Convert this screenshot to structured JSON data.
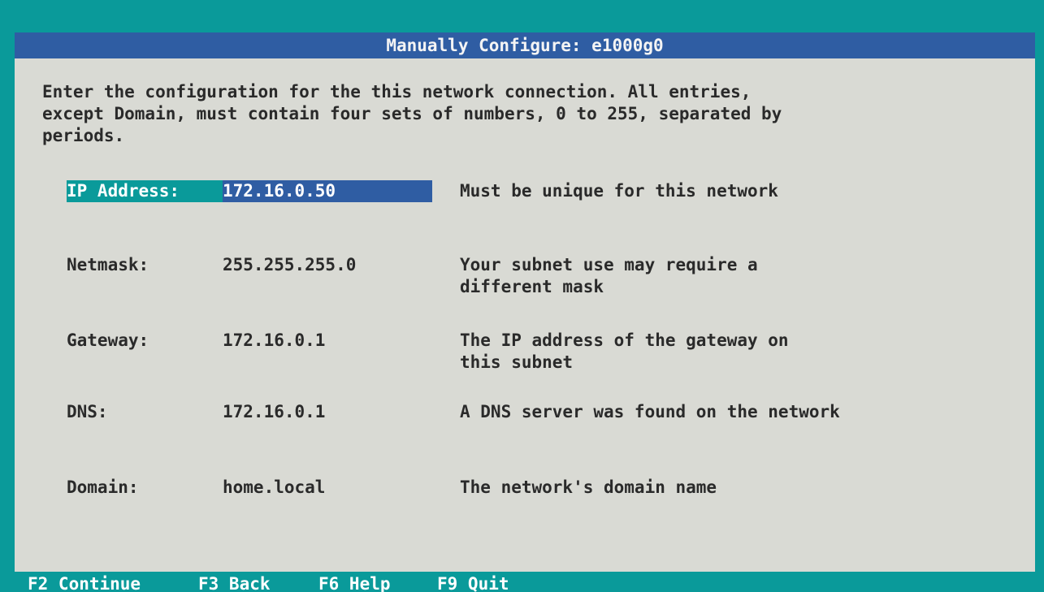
{
  "dialog": {
    "title": "Manually Configure: e1000g0",
    "intro": "Enter the configuration for the this network connection. All entries,\nexcept Domain, must contain four sets of numbers, 0 to 255, separated by\nperiods."
  },
  "fields": [
    {
      "label": "IP Address:",
      "value": "172.16.0.50",
      "hint": "Must be unique for this network"
    },
    {
      "label": "Netmask:",
      "value": "255.255.255.0",
      "hint": "Your subnet use may require a\ndifferent mask"
    },
    {
      "label": "Gateway:",
      "value": "172.16.0.1",
      "hint": "The IP address of the gateway on\nthis subnet"
    },
    {
      "label": "DNS:",
      "value": "172.16.0.1",
      "hint": "A DNS server was found on the network"
    },
    {
      "label": "Domain:",
      "value": "home.local",
      "hint": "The network's domain name"
    }
  ],
  "footer": {
    "continue": "F2 Continue",
    "back": "F3 Back",
    "help": "F6 Help",
    "quit": "F9 Quit"
  },
  "colors": {
    "background": "#0a9a9a",
    "dialog": "#d9dad4",
    "titlebar": "#2f5da3",
    "focus_label": "#0a9a9a",
    "focus_value": "#2f5da3"
  }
}
